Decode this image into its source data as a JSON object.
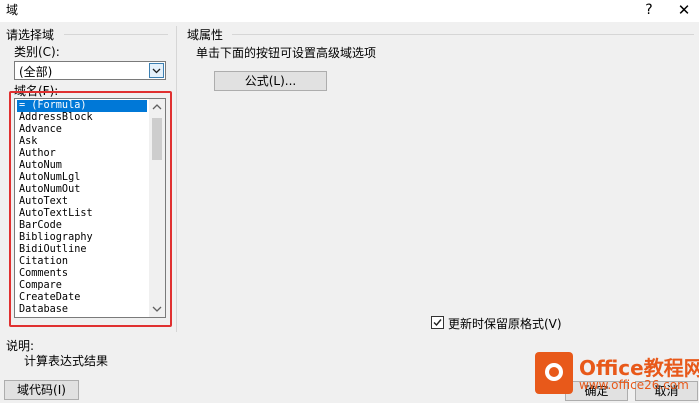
{
  "window": {
    "title": "域",
    "help": "?",
    "close": "✕"
  },
  "left_group": {
    "heading": "请选择域",
    "category_label": "类别(C):",
    "category_value": "(全部)",
    "field_names_label": "域名(F):",
    "field_names": [
      "= (Formula)",
      "AddressBlock",
      "Advance",
      "Ask",
      "Author",
      "AutoNum",
      "AutoNumLgl",
      "AutoNumOut",
      "AutoText",
      "AutoTextList",
      "BarCode",
      "Bibliography",
      "BidiOutline",
      "Citation",
      "Comments",
      "Compare",
      "CreateDate",
      "Database"
    ],
    "selected_index": 0
  },
  "right_group": {
    "heading": "域属性",
    "hint": "单击下面的按钮可设置高级域选项",
    "formula_button": "公式(L)...",
    "preserve_format": {
      "label": "更新时保留原格式(V)",
      "checked": true
    }
  },
  "description": {
    "heading": "说明:",
    "text": "计算表达式结果"
  },
  "buttons": {
    "field_codes": "域代码(I)",
    "ok": "确定",
    "cancel": "取消"
  },
  "watermark": {
    "title": "Office教程网",
    "url": "www.office26.com"
  },
  "colors": {
    "selection": "#0078d7",
    "highlight_border": "#e03030",
    "watermark": "#e8591a"
  }
}
